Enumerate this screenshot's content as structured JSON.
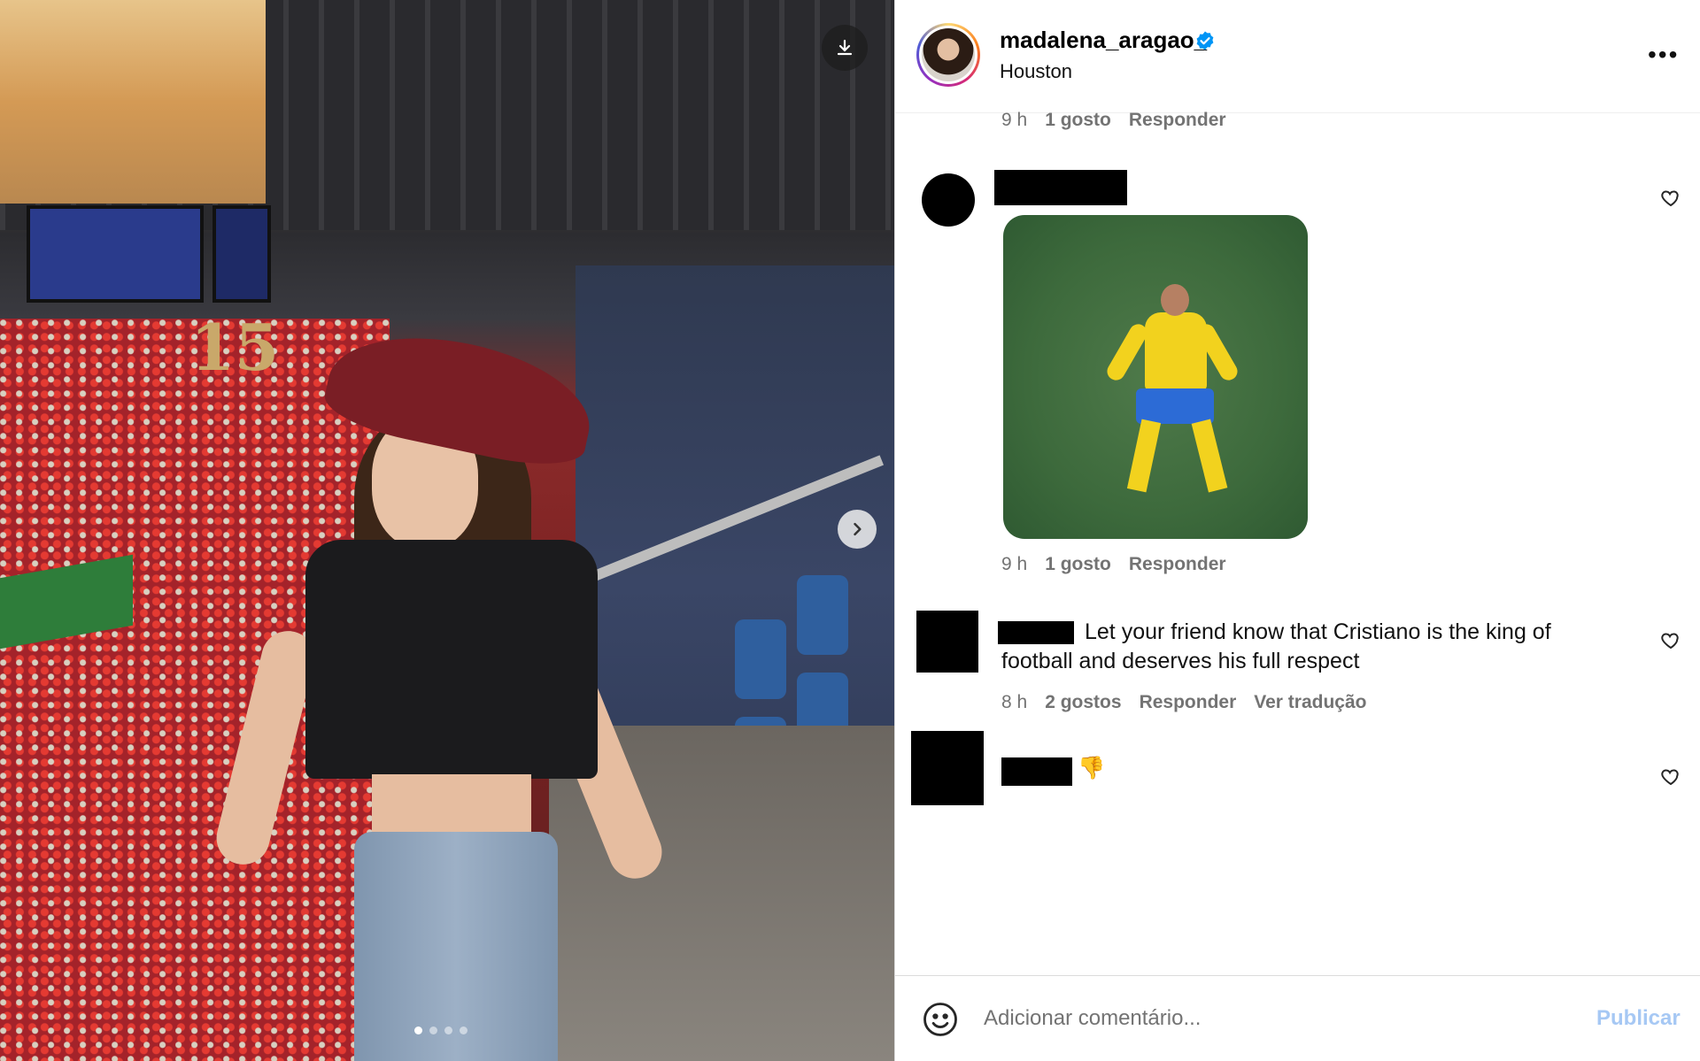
{
  "post": {
    "username": "madalena_aragao_",
    "location": "Houston",
    "verified_icon": "verified-badge-icon",
    "jersey_number": "15",
    "carousel": {
      "total": 4,
      "active": 1
    }
  },
  "comments": [
    {
      "time": "9 h",
      "likes": "1 gosto",
      "reply": "Responder"
    },
    {
      "time": "9 h",
      "likes": "1 gosto",
      "reply": "Responder",
      "has_gif": true
    },
    {
      "text": "Let your friend know that Cristiano is the king of football and deserves his full respect",
      "time": "8 h",
      "likes": "2 gostos",
      "reply": "Responder",
      "translate": "Ver tradução"
    },
    {
      "emoji": "👎"
    }
  ],
  "footer": {
    "placeholder": "Adicionar comentário...",
    "publish_label": "Publicar"
  },
  "colors": {
    "publish_disabled": "#a6c8f4",
    "verified": "#0095f6",
    "meta_gray": "#737373"
  }
}
